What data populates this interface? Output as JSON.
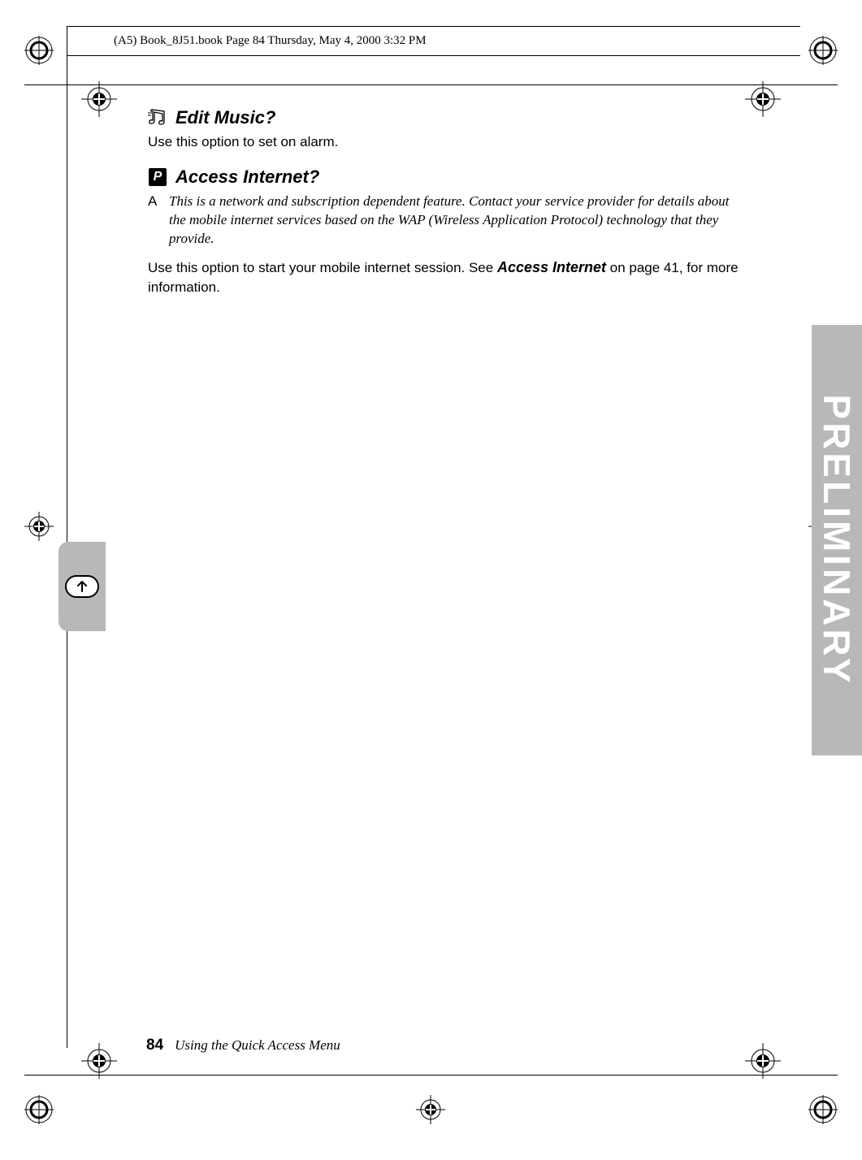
{
  "header": {
    "filepath_line": "(A5) Book_8J51.book  Page 84  Thursday, May 4, 2000  3:32 PM"
  },
  "section_music": {
    "title": "Edit Music?",
    "body": "Use this option to set on alarm."
  },
  "section_internet": {
    "title": "Access Internet?",
    "icon_letter": "P",
    "note_letter": "A",
    "note": "This is a network and subscription dependent feature. Contact your service provider for details about the mobile internet services based on the WAP (Wireless Application Protocol) technology that they provide.",
    "body_pre": "Use this option to start your mobile internet session. See ",
    "body_link": "Access Internet",
    "body_post": " on page 41, for more information."
  },
  "side_tab": {
    "label": "PRELIMINARY"
  },
  "footer": {
    "page_number": "84",
    "chapter_title": "Using the Quick Access Menu"
  }
}
